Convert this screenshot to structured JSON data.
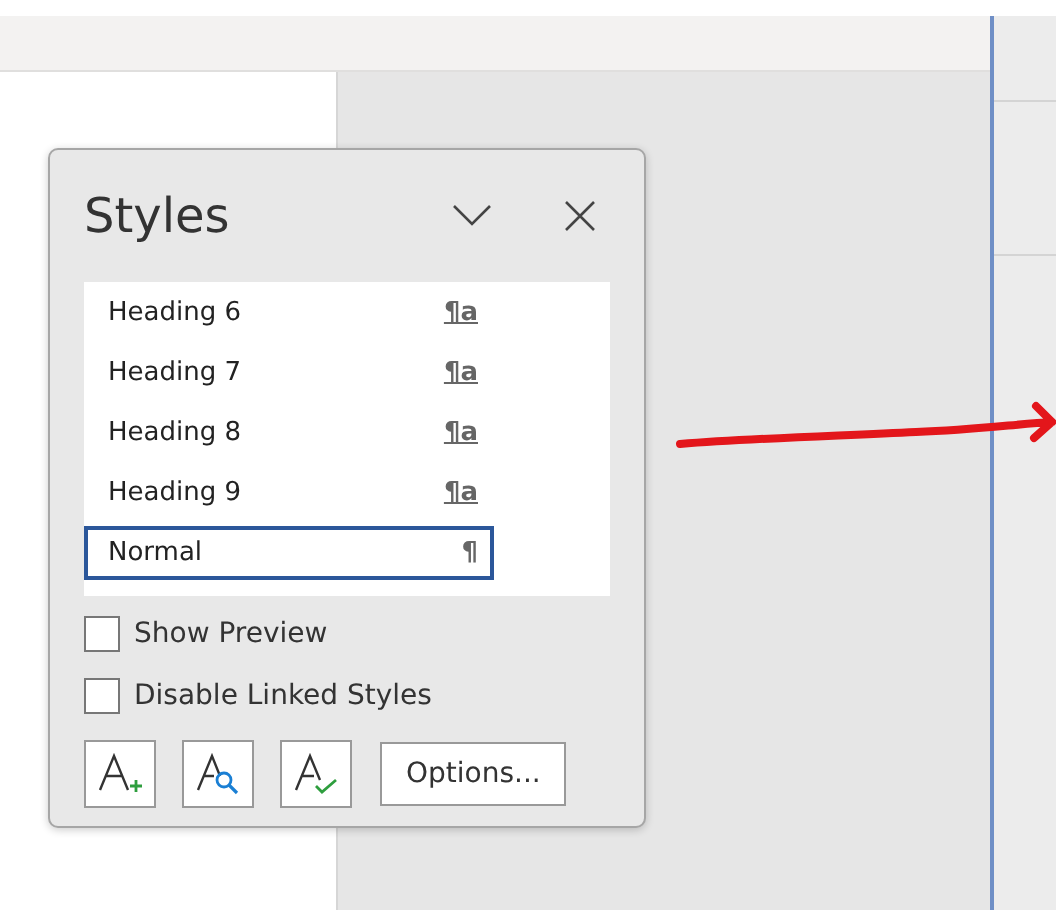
{
  "panel": {
    "title": "Styles",
    "styles": [
      {
        "label": "Heading 6",
        "symbol": "¶a",
        "linked": true,
        "selected": false
      },
      {
        "label": "Heading 7",
        "symbol": "¶a",
        "linked": true,
        "selected": false
      },
      {
        "label": "Heading 8",
        "symbol": "¶a",
        "linked": true,
        "selected": false
      },
      {
        "label": "Heading 9",
        "symbol": "¶a",
        "linked": true,
        "selected": false
      },
      {
        "label": "Normal",
        "symbol": "¶",
        "linked": false,
        "selected": true
      }
    ],
    "options": [
      {
        "label": "Show Preview",
        "checked": false
      },
      {
        "label": "Disable Linked Styles",
        "checked": false
      }
    ],
    "tools": [
      {
        "kind": "new-style"
      },
      {
        "kind": "inspector"
      },
      {
        "kind": "manage"
      }
    ],
    "options_button": "Options..."
  }
}
